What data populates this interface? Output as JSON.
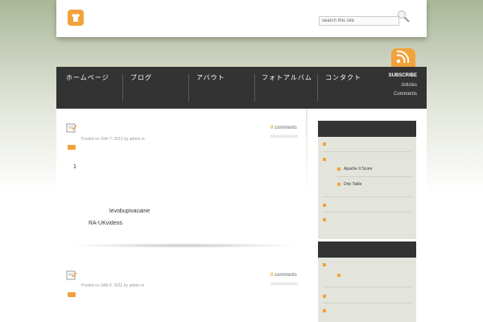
{
  "header": {
    "search": {
      "placeholder": "search this site",
      "value": "search this site"
    }
  },
  "nav": {
    "items": [
      "ホームページ",
      "ブログ",
      "アバウト",
      "フォトアルバム",
      "コンタクト"
    ],
    "subscribe": "SUBSCRIBE",
    "articles": "Articles",
    "comments": "Comments"
  },
  "posts": [
    {
      "meta": "Posted on 10th 7. 2012 by admin in",
      "comment_count": "0",
      "comment_label": "comments",
      "text_number": "1",
      "text_line1": "levobupivacaine",
      "text_line2": "RA-UKvideos"
    },
    {
      "meta": "Posted on 24th 5. 2011 by admin in",
      "comment_count": "0",
      "comment_label": "comments"
    }
  ],
  "sidebar": {
    "widget1": {
      "sub_items": [
        "Apache II Score",
        "Drip Table"
      ]
    }
  },
  "colors": {
    "accent": "#f2a23a",
    "dark": "#333333",
    "widget_bg": "#e3e5dc"
  }
}
